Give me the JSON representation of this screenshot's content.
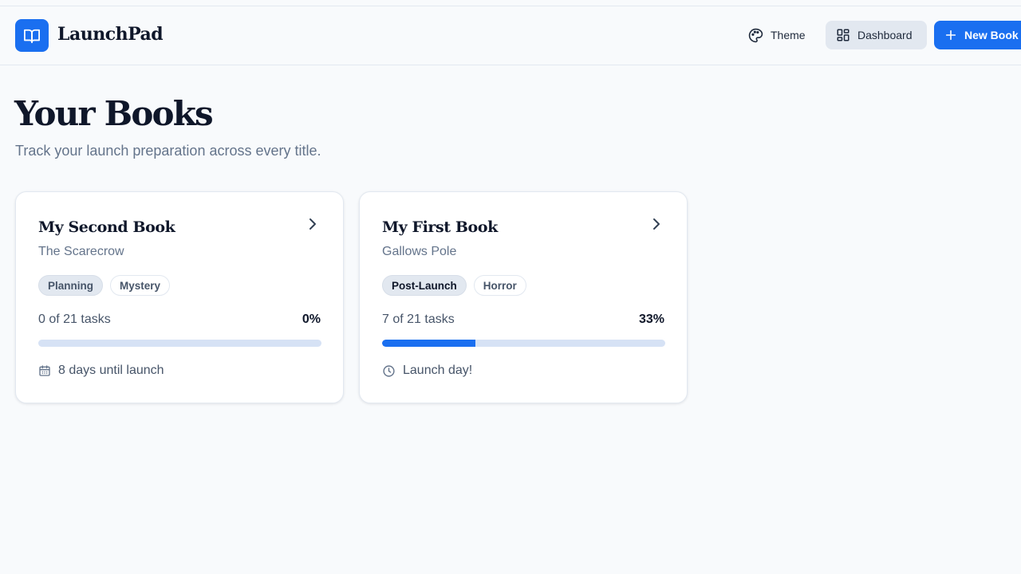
{
  "app": {
    "name": "LaunchPad",
    "brand_color": "#1a6ff0",
    "logo_icon": "open-book-icon"
  },
  "nav": {
    "theme_label": "Theme",
    "theme_icon": "palette-icon",
    "dashboard_label": "Dashboard",
    "dashboard_icon": "layout-grid-icon",
    "new_book_label": "New Book",
    "new_book_icon": "plus-icon"
  },
  "page": {
    "title": "Your Books",
    "subtitle": "Track your launch preparation across every title."
  },
  "books": [
    {
      "title": "My Second Book",
      "subtitle": "The Scarecrow",
      "status": "Planning",
      "genre": "Mystery",
      "tasks_text": "0 of 21 tasks",
      "percent_text": "0%",
      "progress": 0,
      "footer_icon": "calendar-icon",
      "footer_text": "8 days until launch"
    },
    {
      "title": "My First Book",
      "subtitle": "Gallows Pole",
      "status": "Post-Launch",
      "genre": "Horror",
      "tasks_text": "7 of 21 tasks",
      "percent_text": "33%",
      "progress": 0.33,
      "footer_icon": "clock-icon",
      "footer_text": "Launch day!"
    }
  ]
}
